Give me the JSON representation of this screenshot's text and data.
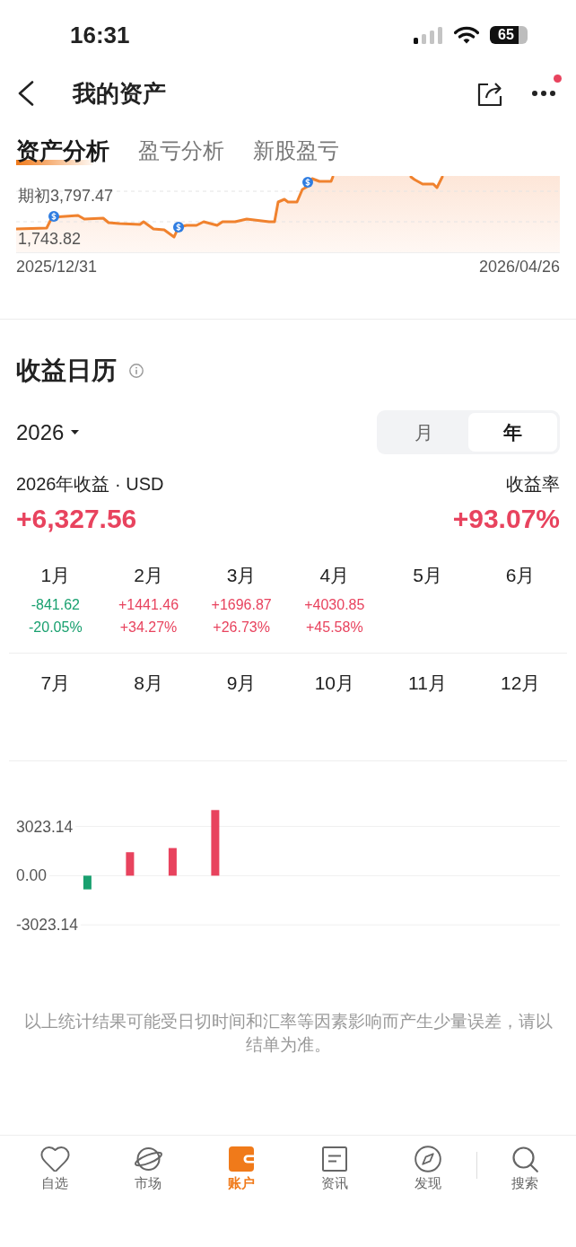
{
  "status_bar": {
    "time": "16:31",
    "battery": "65"
  },
  "header": {
    "title": "我的资产",
    "more_badge": true
  },
  "tabs": [
    {
      "label": "资产分析",
      "selected": true
    },
    {
      "label": "盈亏分析",
      "selected": false
    },
    {
      "label": "新股盈亏",
      "selected": false
    }
  ],
  "asset_chart": {
    "upper_label": "期初3,797.47",
    "lower_label": "1,743.82",
    "start_date": "2025/12/31",
    "end_date": "2026/04/26"
  },
  "profit_calendar": {
    "title": "收益日历",
    "year": "2026",
    "periods": [
      {
        "label": "月",
        "selected": false
      },
      {
        "label": "年",
        "selected": true
      }
    ],
    "summary_label": "2026年收益 · USD",
    "total": "+6,327.56",
    "rate_label": "收益率",
    "rate": "+93.07%",
    "months": [
      {
        "label": "1月",
        "profit": "-841.62",
        "rate": "-20.05%",
        "color": "#19a06f"
      },
      {
        "label": "2月",
        "profit": "+1441.46",
        "rate": "+34.27%",
        "color": "#e8435e"
      },
      {
        "label": "3月",
        "profit": "+1696.87",
        "rate": "+26.73%",
        "color": "#e8435e"
      },
      {
        "label": "4月",
        "profit": "+4030.85",
        "rate": "+45.58%",
        "color": "#e8435e"
      },
      {
        "label": "5月"
      },
      {
        "label": "6月"
      },
      {
        "label": "7月"
      },
      {
        "label": "8月"
      },
      {
        "label": "9月"
      },
      {
        "label": "10月"
      },
      {
        "label": "11月"
      },
      {
        "label": "12月"
      }
    ],
    "chart_data": {
      "type": "bar",
      "values": [
        -841.62,
        1441.46,
        1696.87,
        4030.85,
        null,
        null,
        null,
        null,
        null,
        null,
        null,
        null
      ],
      "ylim": [
        -3023.14,
        4030.85
      ],
      "yticks": [
        {
          "value": 3023.14,
          "label": "3023.14"
        },
        {
          "value": 0,
          "label": "0.00"
        },
        {
          "value": -3023.14,
          "label": "-3023.14"
        }
      ],
      "grid": true
    }
  },
  "disclaimer": "以上统计结果可能受日切时间和汇率等因素影响而产生少量误差，请以结单为准。",
  "bottom_nav": [
    {
      "label": "自选",
      "selected": false,
      "kind": "tab"
    },
    {
      "label": "市场",
      "selected": false,
      "kind": "tab"
    },
    {
      "label": "账户",
      "selected": true,
      "kind": "tab"
    },
    {
      "label": "资讯",
      "selected": false,
      "kind": "tab"
    },
    {
      "label": "发现",
      "selected": false,
      "kind": "tab"
    },
    {
      "label": "搜索",
      "selected": false,
      "kind": "action"
    }
  ]
}
